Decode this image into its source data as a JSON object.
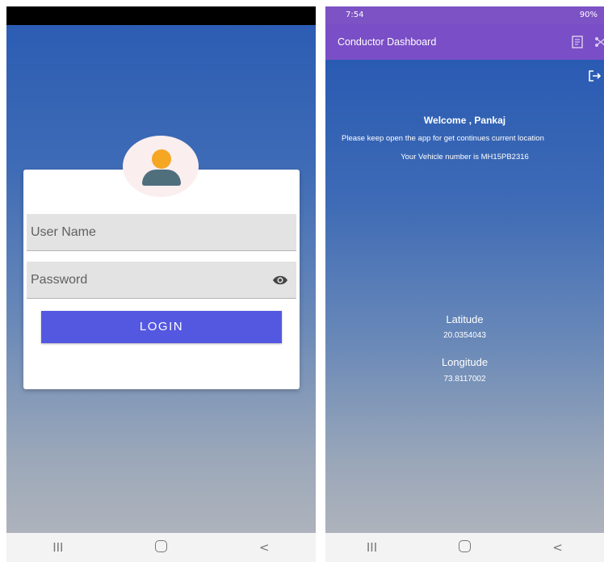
{
  "login_screen": {
    "username_placeholder": "User Name",
    "password_placeholder": "Password",
    "login_label": "LOGIN",
    "nav": {
      "recents": "III",
      "back": "<"
    }
  },
  "dashboard": {
    "status": {
      "time": "7:54",
      "battery": "90%"
    },
    "appbar_title": "Conductor Dashboard",
    "welcome": "Welcome , Pankaj",
    "instruction": "Please keep open the app for get continues current location",
    "vehicle": "Your Vehicle number is MH15PB2316",
    "latitude_label": "Latitude",
    "latitude_value": "20.0354043",
    "longitude_label": "Longitude",
    "longitude_value": "73.8117002",
    "nav": {
      "recents": "III",
      "back": "<"
    }
  },
  "colors": {
    "primary": "#7a4ec6",
    "login_button": "#5458e0",
    "avatar_head": "#f5a623",
    "avatar_body": "#4f6f7d"
  }
}
